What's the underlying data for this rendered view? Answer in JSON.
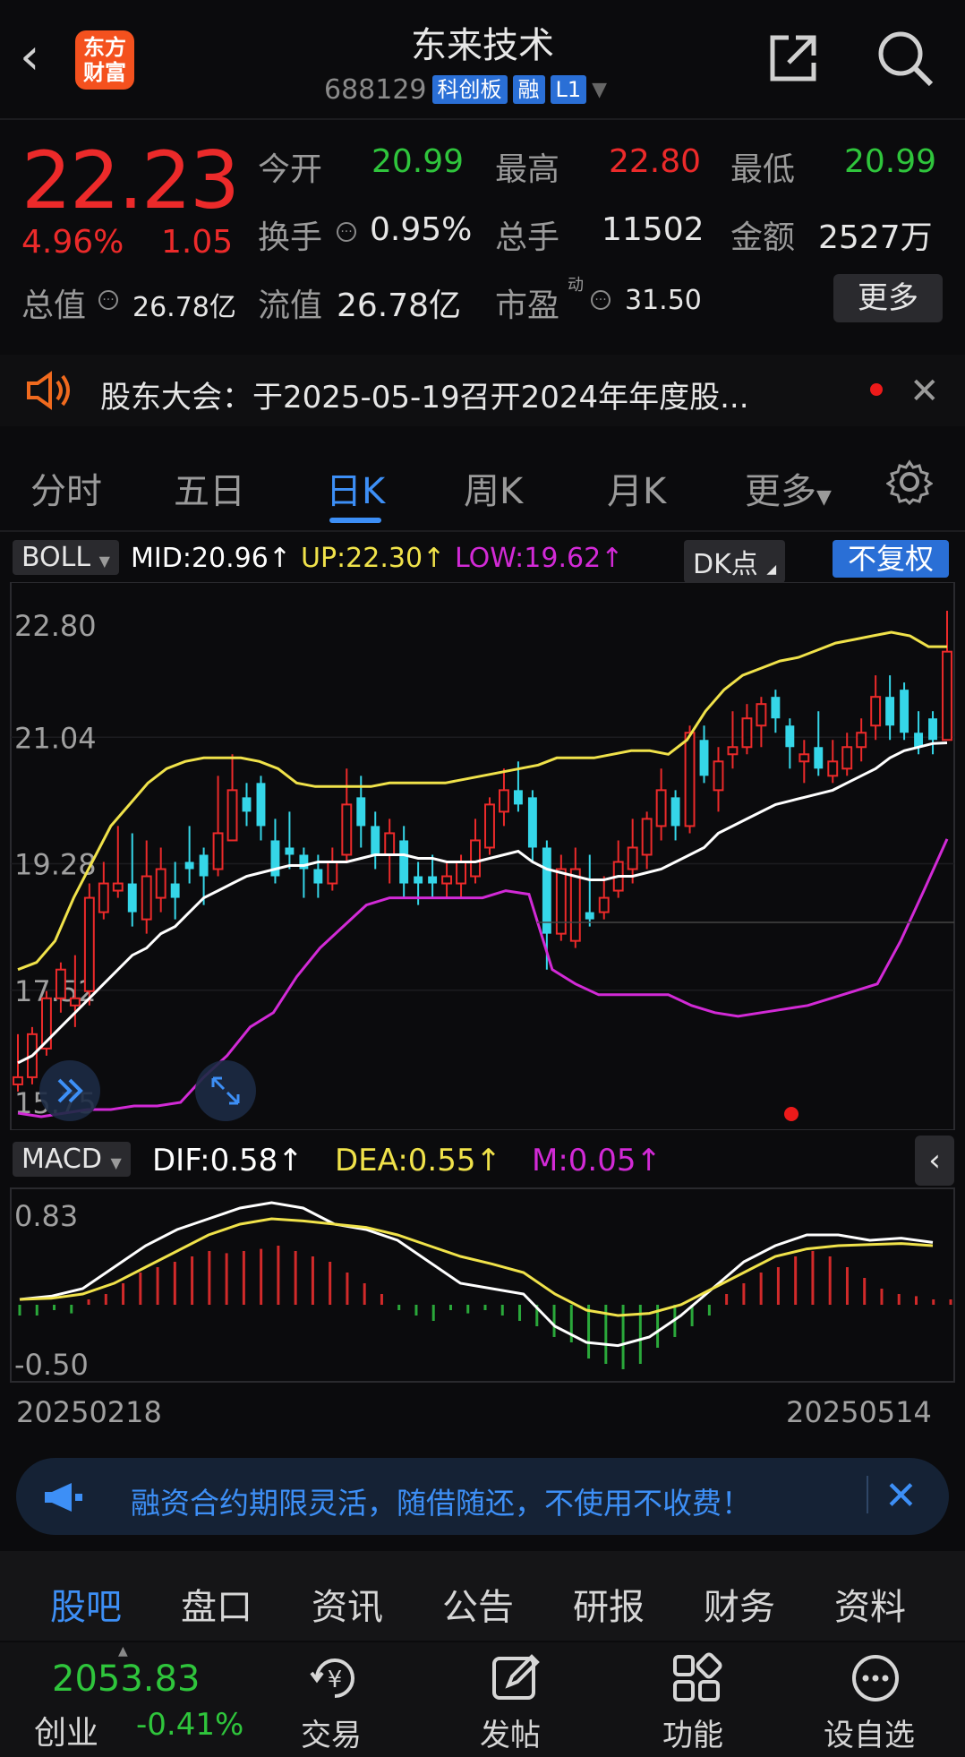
{
  "header": {
    "title": "东来技术",
    "code": "688129",
    "tags": [
      "科创板",
      "融",
      "L1"
    ],
    "logo_text": [
      "东方",
      "财富"
    ]
  },
  "quote": {
    "price": "22.23",
    "change_pct": "4.96%",
    "change": "1.05",
    "rows": [
      [
        {
          "label": "今开",
          "value": "20.99",
          "color": "green"
        },
        {
          "label": "最高",
          "value": "22.80",
          "color": "red"
        },
        {
          "label": "最低",
          "value": "20.99",
          "color": "green"
        }
      ],
      [
        {
          "label": "换手",
          "value": "0.95%",
          "color": "white"
        },
        {
          "label": "总手",
          "value": "11502",
          "color": "white"
        },
        {
          "label": "金额",
          "value": "2527万",
          "color": "white"
        }
      ],
      [
        {
          "label": "总值",
          "value": "26.78亿",
          "color": "white"
        },
        {
          "label": "流值",
          "value": "26.78亿",
          "color": "white"
        },
        {
          "label": "市盈",
          "value": "31.50",
          "color": "white",
          "superscript": "动"
        }
      ]
    ],
    "more_label": "更多"
  },
  "notice": {
    "text": "股东大会：于2025-05-19召开2024年年度股..."
  },
  "period_tabs": [
    "分时",
    "五日",
    "日K",
    "周K",
    "月K",
    "更多"
  ],
  "active_period": "日K",
  "indicator": {
    "name": "BOLL",
    "mid": "MID:20.96↑",
    "up": "UP:22.30↑",
    "low": "LOW:19.62↑",
    "dk_label": "DK点",
    "restore_label": "不复权"
  },
  "k_axis": [
    "22.80",
    "21.04",
    "19.28",
    "17.52",
    "15.75"
  ],
  "macd": {
    "name": "MACD",
    "dif": "DIF:0.58↑",
    "dea": "DEA:0.55↑",
    "m": "M:0.05↑",
    "axis": [
      "0.83",
      "-0.50"
    ]
  },
  "dates": {
    "start": "20250218",
    "end": "20250514"
  },
  "promo": {
    "text": "融资合约期限灵活，随借随还，不使用不收费！"
  },
  "bottom_tabs": [
    "股吧",
    "盘口",
    "资讯",
    "公告",
    "研报",
    "财务",
    "资料"
  ],
  "toolbar": {
    "index_value": "2053.83",
    "index_name": "创业",
    "index_change": "-0.41%",
    "items": [
      "交易",
      "发帖",
      "功能",
      "设自选"
    ]
  },
  "colors": {
    "up": "#ec2a2a",
    "down": "#2fc53c",
    "cyan": "#35d6e8",
    "mid": "#ffffff",
    "upper": "#f0e24a",
    "lower": "#d22ad6",
    "accent": "#3d8ff6"
  },
  "chart_data": {
    "type": "candlestick",
    "title": "",
    "ylim": [
      15.75,
      22.8
    ],
    "candles": [
      [
        16.2,
        16.3,
        16.9,
        16.1
      ],
      [
        16.3,
        16.9,
        17.0,
        16.2
      ],
      [
        16.7,
        17.4,
        17.5,
        16.6
      ],
      [
        17.4,
        17.8,
        17.9,
        17.2
      ],
      [
        17.3,
        17.4,
        18.0,
        17.0
      ],
      [
        17.5,
        18.8,
        19.0,
        17.3
      ],
      [
        18.6,
        19.0,
        19.3,
        18.5
      ],
      [
        18.9,
        19.0,
        19.8,
        18.8
      ],
      [
        19.0,
        18.6,
        19.7,
        18.4
      ],
      [
        18.5,
        19.1,
        19.6,
        18.3
      ],
      [
        18.8,
        19.2,
        19.5,
        18.6
      ],
      [
        19.0,
        18.8,
        19.3,
        18.5
      ],
      [
        19.3,
        19.2,
        19.8,
        19.0
      ],
      [
        19.4,
        19.1,
        19.5,
        18.7
      ],
      [
        19.2,
        19.7,
        20.5,
        19.1
      ],
      [
        19.6,
        20.3,
        20.8,
        19.6
      ],
      [
        20.2,
        20.0,
        20.4,
        19.8
      ],
      [
        20.4,
        19.8,
        20.5,
        19.6
      ],
      [
        19.6,
        19.1,
        19.9,
        19.0
      ],
      [
        19.5,
        19.4,
        20.0,
        19.2
      ],
      [
        19.4,
        19.2,
        19.5,
        18.8
      ],
      [
        19.2,
        19.0,
        19.4,
        18.8
      ],
      [
        19.0,
        19.3,
        19.5,
        18.9
      ],
      [
        19.4,
        20.1,
        20.6,
        19.3
      ],
      [
        20.2,
        19.8,
        20.5,
        19.5
      ],
      [
        19.8,
        19.4,
        20.0,
        19.2
      ],
      [
        19.4,
        19.7,
        19.9,
        19.0
      ],
      [
        19.6,
        19.0,
        19.8,
        18.8
      ],
      [
        19.1,
        19.0,
        19.3,
        18.7
      ],
      [
        19.1,
        19.0,
        19.4,
        18.8
      ],
      [
        19.0,
        19.1,
        19.3,
        18.8
      ],
      [
        19.0,
        19.3,
        19.4,
        18.8
      ],
      [
        19.1,
        19.6,
        19.9,
        19.0
      ],
      [
        19.5,
        20.1,
        20.2,
        19.4
      ],
      [
        20.0,
        20.3,
        20.6,
        19.8
      ],
      [
        20.3,
        20.1,
        20.7,
        20.0
      ],
      [
        20.2,
        19.5,
        20.3,
        19.3
      ],
      [
        19.5,
        18.3,
        19.6,
        17.8
      ],
      [
        18.3,
        19.2,
        19.4,
        18.2
      ],
      [
        18.2,
        19.2,
        19.5,
        18.1
      ],
      [
        18.6,
        18.5,
        19.4,
        18.4
      ],
      [
        18.6,
        18.8,
        19.1,
        18.5
      ],
      [
        18.9,
        19.3,
        19.6,
        18.8
      ],
      [
        19.2,
        19.5,
        19.9,
        19.0
      ],
      [
        19.4,
        19.9,
        20.0,
        19.2
      ],
      [
        19.8,
        20.3,
        20.6,
        19.6
      ],
      [
        20.2,
        19.8,
        20.3,
        19.6
      ],
      [
        19.8,
        21.1,
        21.2,
        19.7
      ],
      [
        21.0,
        20.5,
        21.2,
        20.4
      ],
      [
        20.3,
        20.7,
        20.9,
        20.0
      ],
      [
        20.8,
        20.9,
        21.4,
        20.6
      ],
      [
        20.9,
        21.3,
        21.5,
        20.8
      ],
      [
        21.2,
        21.5,
        21.6,
        20.9
      ],
      [
        21.6,
        21.3,
        21.7,
        21.1
      ],
      [
        21.2,
        20.9,
        21.3,
        20.6
      ],
      [
        20.7,
        20.8,
        21.0,
        20.4
      ],
      [
        20.9,
        20.6,
        21.4,
        20.5
      ],
      [
        20.5,
        20.7,
        21.0,
        20.4
      ],
      [
        20.6,
        20.9,
        21.1,
        20.5
      ],
      [
        20.9,
        21.1,
        21.3,
        20.7
      ],
      [
        21.2,
        21.6,
        21.9,
        21.0
      ],
      [
        21.6,
        21.2,
        21.9,
        21.0
      ],
      [
        21.7,
        21.1,
        21.8,
        21.0
      ],
      [
        21.1,
        20.9,
        21.4,
        20.8
      ],
      [
        21.3,
        21.0,
        21.4,
        20.8
      ],
      [
        21.0,
        22.23,
        22.8,
        20.99
      ]
    ],
    "boll_mid": [
      16.5,
      16.6,
      16.8,
      17.0,
      17.2,
      17.4,
      17.6,
      17.8,
      18.0,
      18.1,
      18.3,
      18.4,
      18.6,
      18.8,
      18.9,
      19.0,
      19.1,
      19.15,
      19.2,
      19.25,
      19.25,
      19.3,
      19.3,
      19.3,
      19.35,
      19.4,
      19.4,
      19.4,
      19.35,
      19.35,
      19.3,
      19.3,
      19.3,
      19.35,
      19.4,
      19.45,
      19.3,
      19.2,
      19.15,
      19.1,
      19.05,
      19.05,
      19.1,
      19.1,
      19.15,
      19.2,
      19.3,
      19.4,
      19.5,
      19.7,
      19.8,
      19.9,
      20.0,
      20.1,
      20.15,
      20.2,
      20.25,
      20.3,
      20.4,
      20.5,
      20.6,
      20.75,
      20.85,
      20.9,
      20.95,
      20.96
    ],
    "boll_up": [
      17.8,
      17.9,
      18.2,
      18.8,
      19.3,
      19.8,
      20.1,
      20.4,
      20.6,
      20.7,
      20.75,
      20.75,
      20.75,
      20.7,
      20.6,
      20.4,
      20.35,
      20.35,
      20.35,
      20.35,
      20.4,
      20.4,
      20.4,
      20.4,
      20.45,
      20.5,
      20.55,
      20.6,
      20.65,
      20.75,
      20.75,
      20.75,
      20.8,
      20.85,
      20.85,
      20.8,
      21.0,
      21.4,
      21.7,
      21.9,
      22.0,
      22.1,
      22.15,
      22.25,
      22.35,
      22.4,
      22.45,
      22.5,
      22.45,
      22.3,
      22.3
    ],
    "boll_low": [
      15.8,
      15.75,
      15.8,
      15.85,
      15.85,
      15.9,
      15.9,
      15.95,
      16.3,
      16.6,
      17.0,
      17.2,
      17.7,
      18.1,
      18.4,
      18.7,
      18.8,
      18.8,
      18.8,
      18.8,
      18.8,
      18.9,
      18.85,
      17.8,
      17.6,
      17.45,
      17.45,
      17.45,
      17.45,
      17.3,
      17.2,
      17.15,
      17.2,
      17.25,
      17.3,
      17.4,
      17.5,
      17.6,
      18.2,
      18.9,
      19.62
    ],
    "macd_dif": [
      0.05,
      0.08,
      0.15,
      0.35,
      0.55,
      0.7,
      0.8,
      0.9,
      0.95,
      0.9,
      0.75,
      0.7,
      0.6,
      0.4,
      0.2,
      0.15,
      0.1,
      -0.2,
      -0.35,
      -0.38,
      -0.3,
      -0.1,
      0.15,
      0.4,
      0.55,
      0.65,
      0.65,
      0.6,
      0.62,
      0.58
    ],
    "macd_dea": [
      0.05,
      0.06,
      0.1,
      0.2,
      0.35,
      0.5,
      0.65,
      0.75,
      0.8,
      0.78,
      0.75,
      0.72,
      0.65,
      0.55,
      0.45,
      0.38,
      0.3,
      0.1,
      -0.05,
      -0.1,
      -0.08,
      0.0,
      0.15,
      0.3,
      0.45,
      0.52,
      0.55,
      0.56,
      0.57,
      0.55
    ],
    "macd_hist": [
      -0.1,
      -0.1,
      -0.05,
      -0.08,
      0.05,
      0.1,
      0.2,
      0.3,
      0.35,
      0.4,
      0.45,
      0.5,
      0.48,
      0.5,
      0.52,
      0.55,
      0.5,
      0.45,
      0.4,
      0.3,
      0.2,
      0.1,
      -0.05,
      -0.1,
      -0.15,
      -0.05,
      -0.08,
      -0.05,
      -0.1,
      -0.15,
      -0.2,
      -0.3,
      -0.35,
      -0.5,
      -0.55,
      -0.6,
      -0.55,
      -0.4,
      -0.3,
      -0.2,
      -0.1,
      0.1,
      0.2,
      0.3,
      0.35,
      0.45,
      0.5,
      0.45,
      0.35,
      0.25,
      0.15,
      0.1,
      0.08,
      0.05,
      0.05
    ]
  }
}
